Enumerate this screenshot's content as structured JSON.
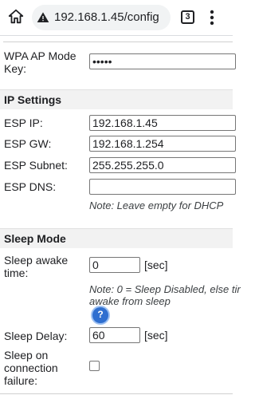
{
  "browser": {
    "url": "192.168.1.45/config",
    "tab_count": "3",
    "icons": [
      "home-icon",
      "warning-icon",
      "tabs-icon",
      "more-vert-icon"
    ]
  },
  "wpa": {
    "label_line1": "WPA AP Mode",
    "label_line2": "Key:",
    "value": "•••••"
  },
  "ip_settings": {
    "title": "IP Settings",
    "esp_ip_label": "ESP IP:",
    "esp_ip_value": "192.168.1.45",
    "esp_gw_label": "ESP GW:",
    "esp_gw_value": "192.168.1.254",
    "esp_subnet_label": "ESP Subnet:",
    "esp_subnet_value": "255.255.255.0",
    "esp_dns_label": "ESP DNS:",
    "esp_dns_value": "",
    "note": "Note: Leave empty for DHCP"
  },
  "sleep_mode": {
    "title": "Sleep Mode",
    "awake_label_line1": "Sleep awake",
    "awake_label_line2": "time:",
    "awake_value": "0",
    "awake_unit": "[sec]",
    "note_line1": "Note: 0 = Sleep Disabled, else tir",
    "note_line2": "awake from sleep",
    "help_symbol": "?",
    "delay_label": "Sleep Delay:",
    "delay_value": "60",
    "delay_unit": "[sec]",
    "failure_label_line1": "Sleep on",
    "failure_label_line2": "connection",
    "failure_label_line3": "failure:",
    "failure_checked": false
  }
}
